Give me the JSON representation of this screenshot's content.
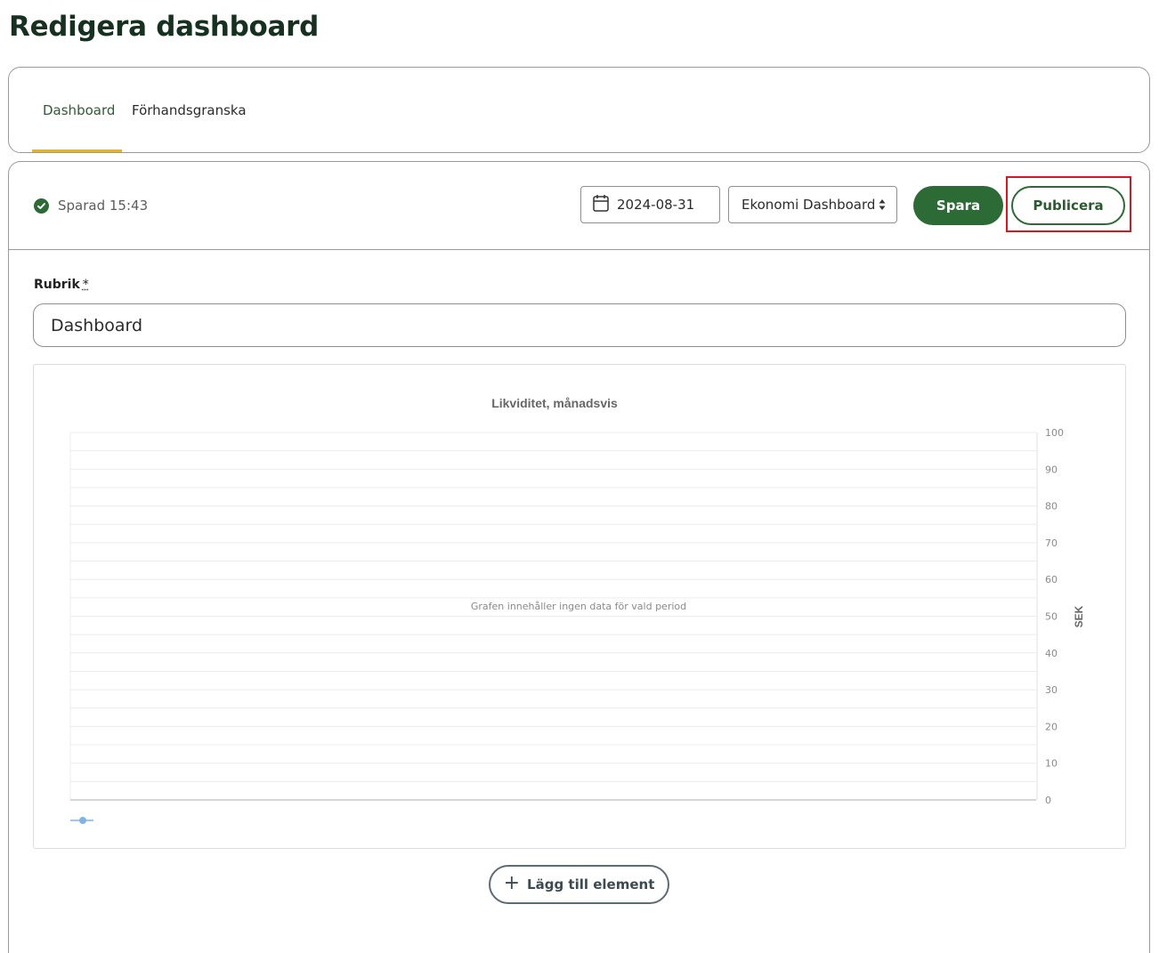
{
  "page": {
    "title": "Redigera dashboard"
  },
  "tabs": [
    {
      "label": "Dashboard",
      "active": true
    },
    {
      "label": "Förhandsgranska",
      "active": false
    }
  ],
  "toolbar": {
    "saved_status": "Sparad 15:43",
    "date": "2024-08-31",
    "dashboard_select": "Ekonomi Dashboard",
    "save_label": "Spara",
    "publish_label": "Publicera"
  },
  "form": {
    "heading_label": "Rubrik",
    "required_mark": "*",
    "heading_value": "Dashboard"
  },
  "chart_data": {
    "type": "line",
    "title": "Likviditet, månadsvis",
    "ylabel": "SEK",
    "xlabel": "",
    "ylim": [
      0,
      100
    ],
    "yticks": [
      "100",
      "90",
      "80",
      "70",
      "60",
      "50",
      "40",
      "30",
      "20",
      "10",
      "0"
    ],
    "y_axis_position": "right",
    "grid": true,
    "empty_message": "Grafen innehåller ingen data för vald period",
    "series": [
      {
        "color": "#7cb5ec",
        "values": []
      }
    ]
  },
  "actions": {
    "add_element_label": "Lägg till element"
  },
  "colors": {
    "brand_green": "#2c6b35",
    "tab_underline": "#e3b628",
    "highlight": "#e0141e",
    "series": "#7cb5ec"
  },
  "icons": {
    "saved": "check-circle-icon",
    "date": "calendar-icon",
    "select": "sort-arrows-icon",
    "add": "plus-icon"
  }
}
